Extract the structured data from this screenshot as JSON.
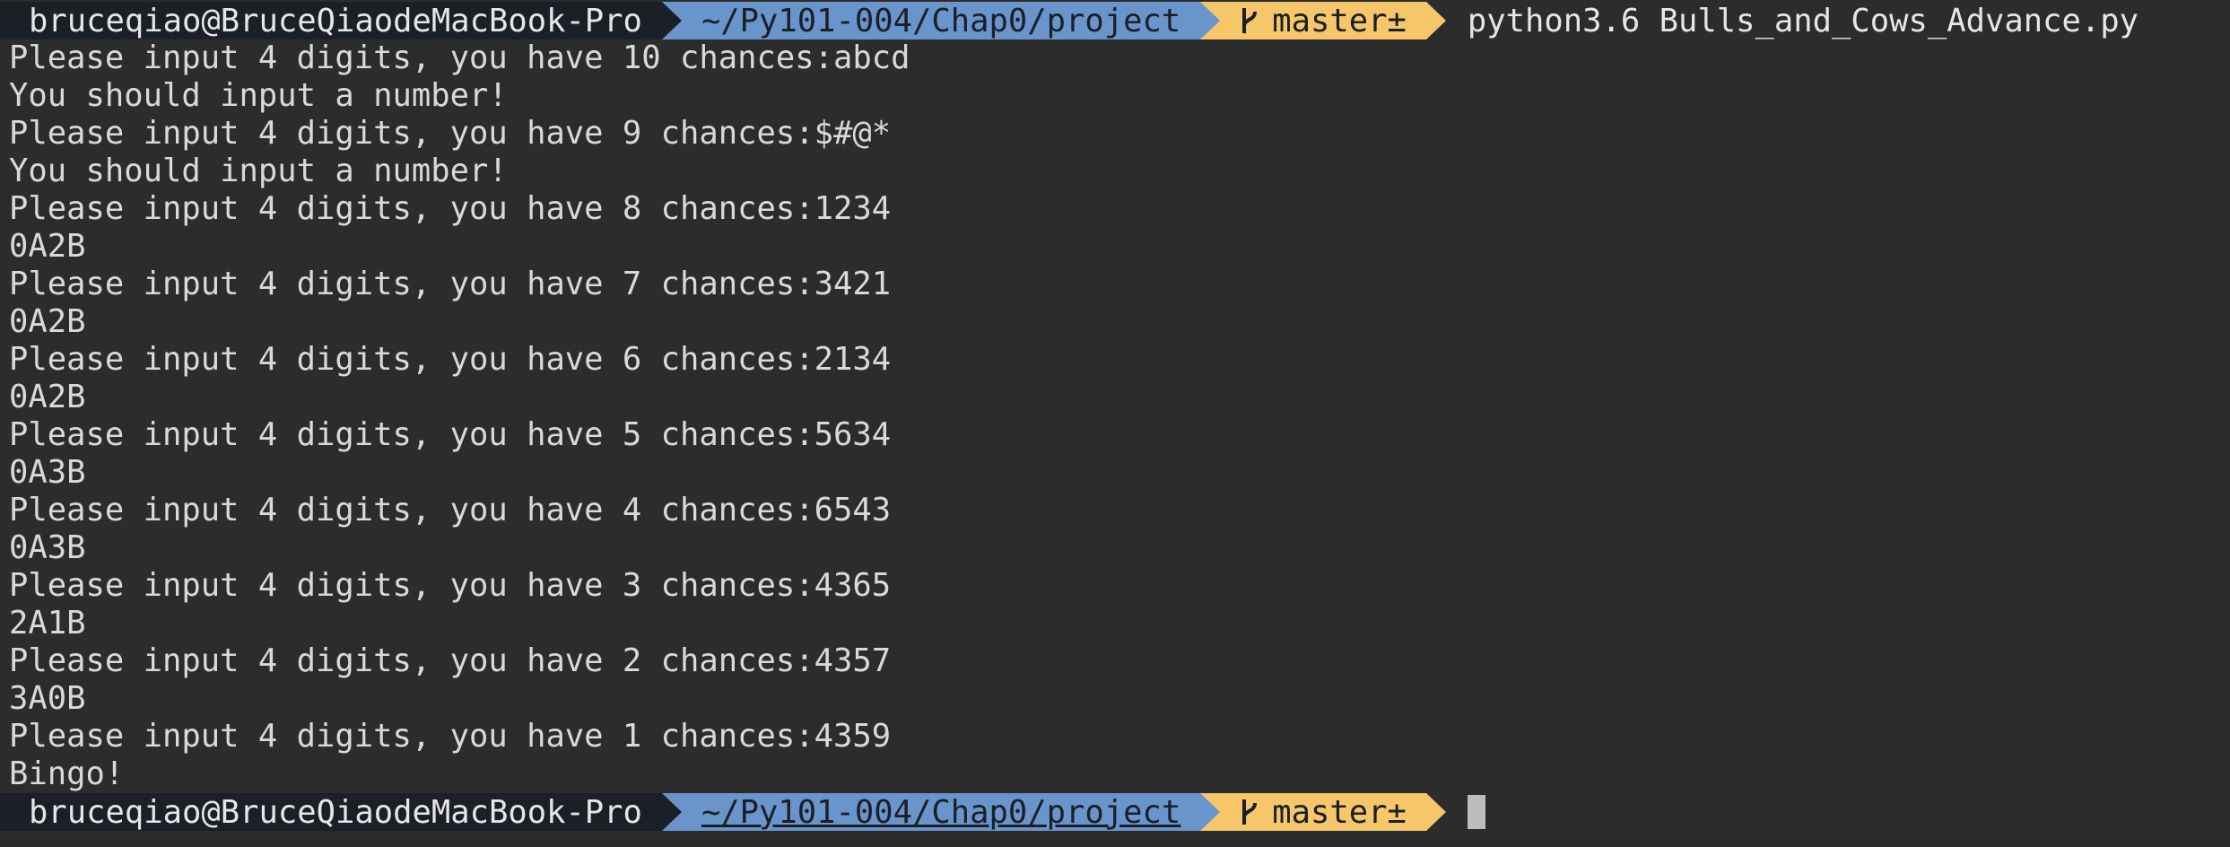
{
  "prompt": {
    "user_host": "bruceqiao@BruceQiaodeMacBook-Pro",
    "path": "~/Py101-004/Chap0/project",
    "branch": "master±",
    "branch_icon": "git-branch-icon"
  },
  "command": "python3.6 Bulls_and_Cows_Advance.py",
  "output": [
    "Please input 4 digits, you have 10 chances:abcd",
    "You should input a number!",
    "Please input 4 digits, you have 9 chances:$#@*",
    "You should input a number!",
    "Please input 4 digits, you have 8 chances:1234",
    "0A2B",
    "Please input 4 digits, you have 7 chances:3421",
    "0A2B",
    "Please input 4 digits, you have 6 chances:2134",
    "0A2B",
    "Please input 4 digits, you have 5 chances:5634",
    "0A3B",
    "Please input 4 digits, you have 4 chances:6543",
    "0A3B",
    "Please input 4 digits, you have 3 chances:4365",
    "2A1B",
    "Please input 4 digits, you have 2 chances:4357",
    "3A0B",
    "Please input 4 digits, you have 1 chances:4359",
    "Bingo!"
  ],
  "colors": {
    "background": "#2c2c2c",
    "text": "#d9d9d9",
    "user_segment": "#1b1f26",
    "path_segment": "#6a94cc",
    "git_segment": "#f6c76a"
  }
}
